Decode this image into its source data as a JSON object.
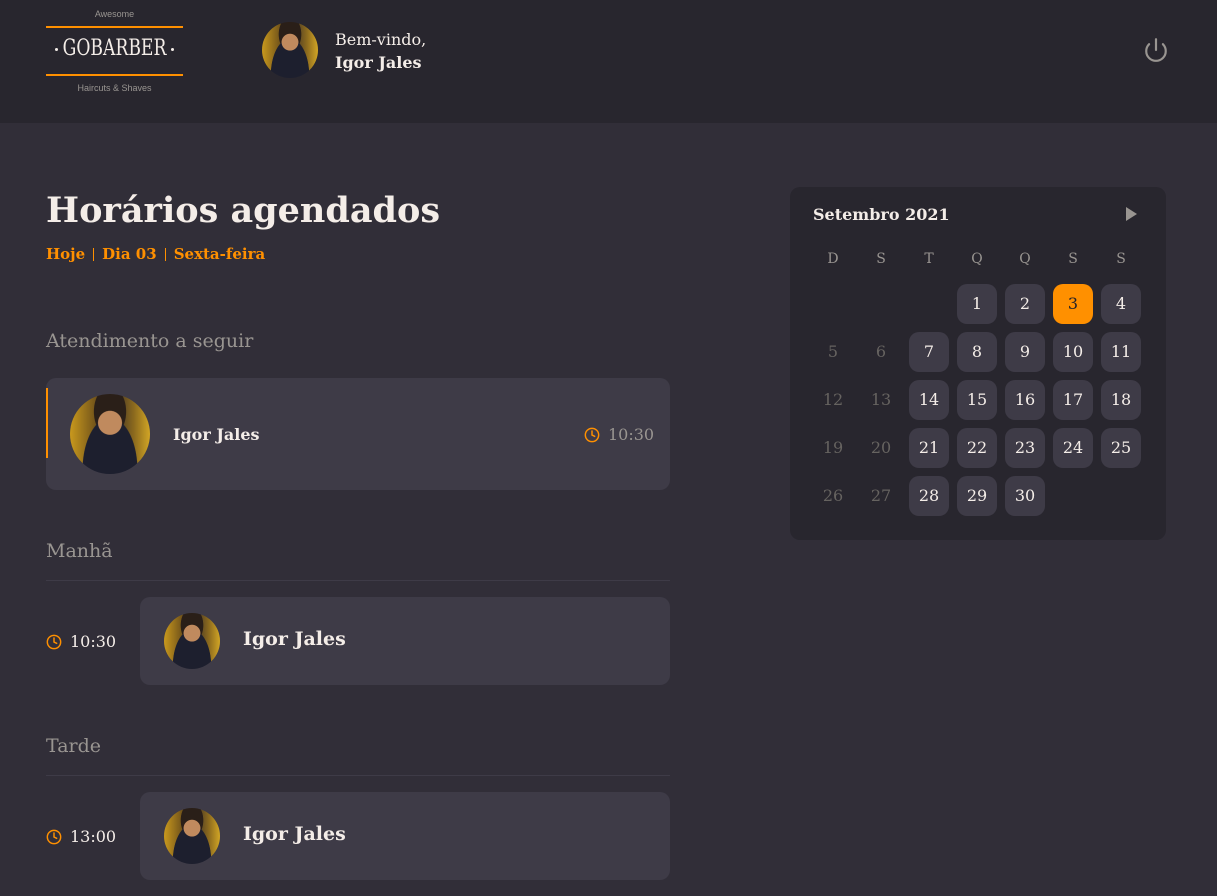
{
  "header": {
    "logo_top": "Awesome",
    "logo_brand": "GOBARBER",
    "logo_bottom": "Haircuts & Shaves",
    "welcome": "Bem-vindo,",
    "user_name": "Igor Jales"
  },
  "main": {
    "title": "Horários agendados",
    "subtitle": {
      "today": "Hoje",
      "day": "Dia 03",
      "weekday": "Sexta-feira"
    },
    "next_label": "Atendimento a seguir",
    "next_appointment": {
      "name": "Igor Jales",
      "time": "10:30"
    },
    "morning": {
      "label": "Manhã",
      "time": "10:30",
      "name": "Igor Jales"
    },
    "afternoon": {
      "label": "Tarde",
      "time": "13:00",
      "name": "Igor Jales"
    }
  },
  "calendar": {
    "month": "Setembro 2021",
    "weekdays": [
      "D",
      "S",
      "T",
      "Q",
      "Q",
      "S",
      "S"
    ],
    "leading_blank_days": 3,
    "days_in_month": 30,
    "selected_day": 3,
    "disabled_days": [
      5,
      6,
      12,
      13,
      19,
      20,
      26,
      27
    ]
  },
  "colors": {
    "accent": "#ff9000",
    "background": "#312e38",
    "header_bg": "#28262e",
    "card_bg": "#3e3b47",
    "text": "#f4ede8",
    "muted": "#999591"
  },
  "icons": {
    "logout": "power-icon",
    "clock": "clock-icon",
    "next_month": "arrow-right-icon"
  }
}
